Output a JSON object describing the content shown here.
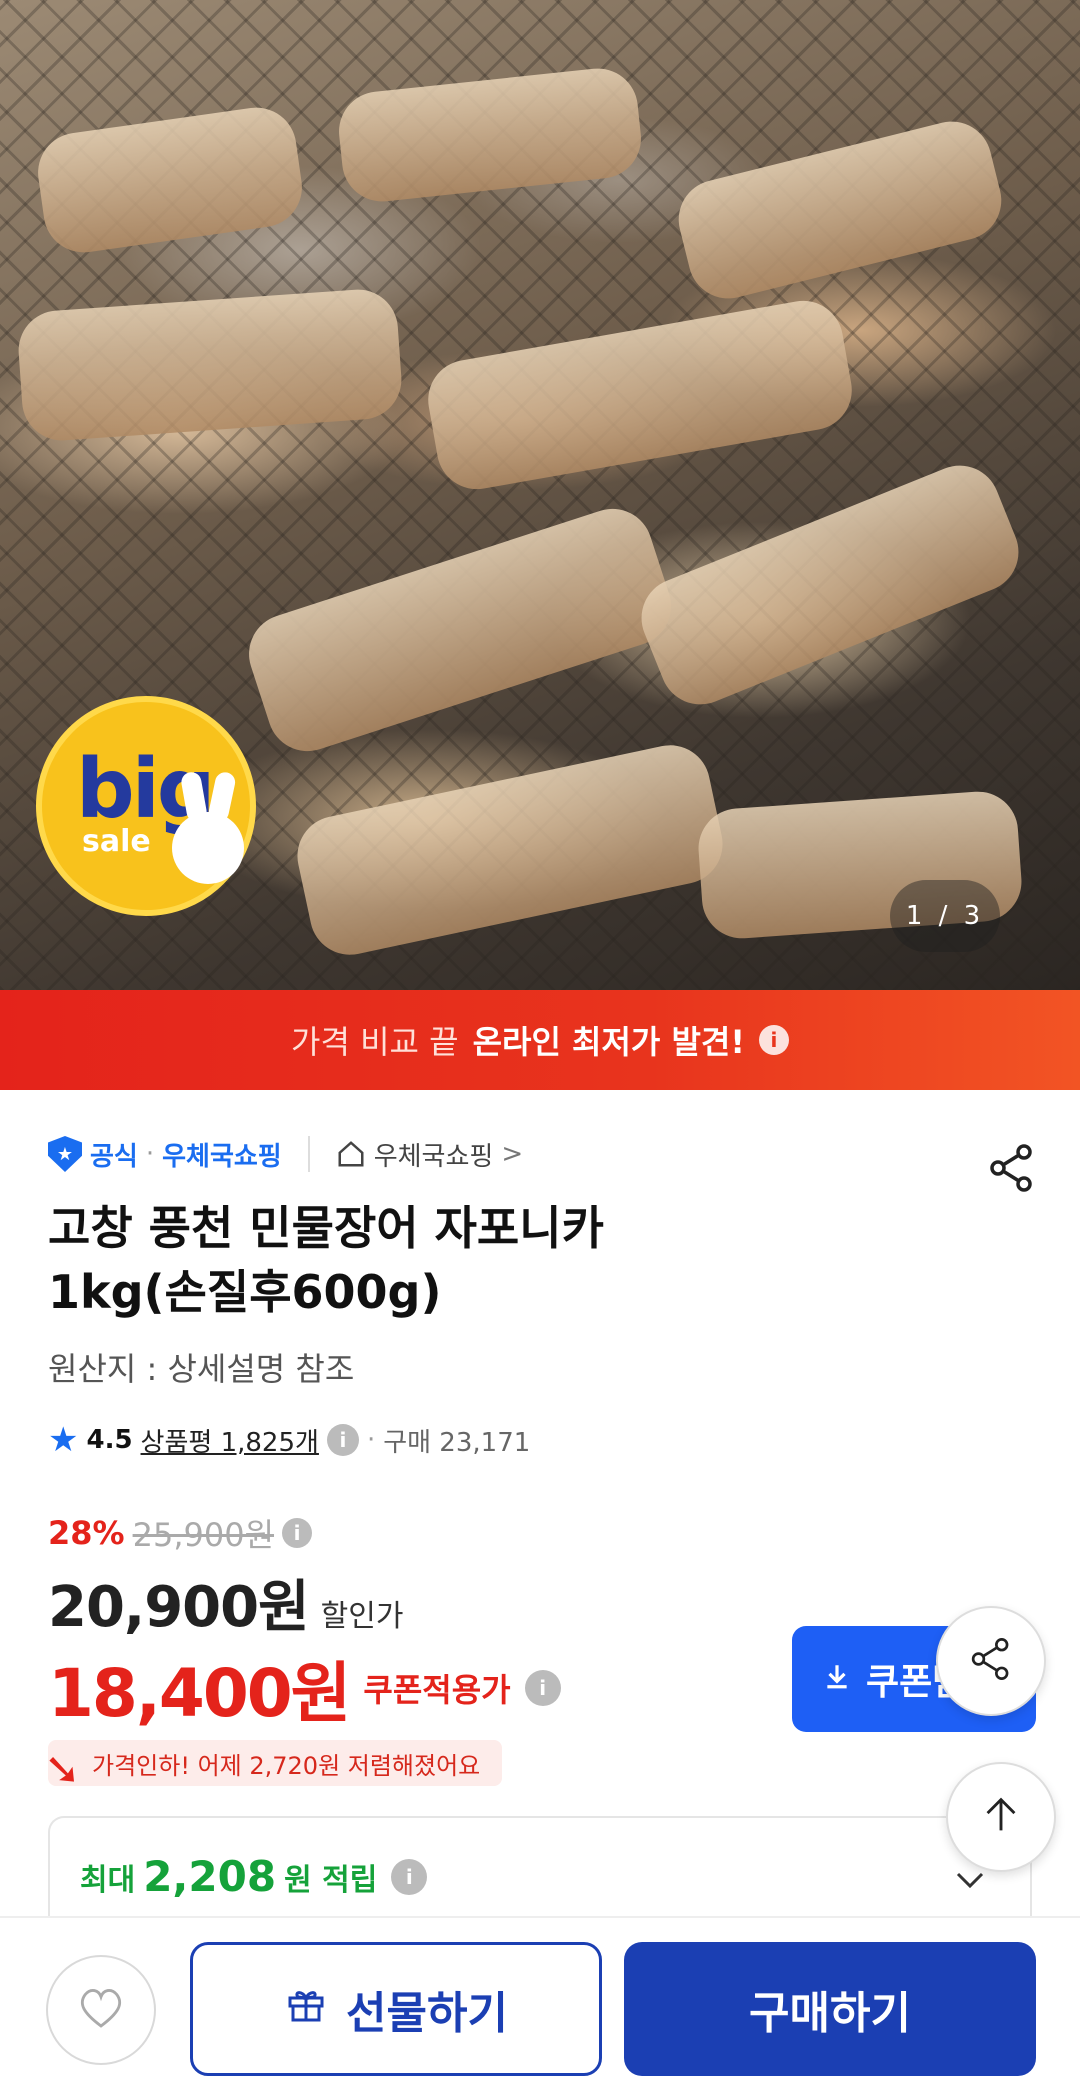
{
  "hero": {
    "badge_big": "big",
    "badge_sale": "sale",
    "image_counter": "1 / 3"
  },
  "banner": {
    "light_text": "가격 비교 끝",
    "bold_text": "온라인 최저가 발견!",
    "info": "i"
  },
  "seller": {
    "official_label": "공식",
    "separator": "·",
    "seller_name": "우체국쇼핑",
    "store_link": "우체국쇼핑",
    "store_chevron": ">"
  },
  "product": {
    "title_line1": "고창 풍천 민물장어 자포니카",
    "title_line2": "1kg(손질후600g)",
    "origin": "원산지 : 상세설명 참조"
  },
  "rating": {
    "score": "4.5",
    "reviews": "상품평 1,825개",
    "separator": "·",
    "bought": "구매 23,171"
  },
  "price": {
    "discount_pct": "28%",
    "original": "25,900원",
    "sale_price": "20,900원",
    "sale_label": "할인가",
    "coupon_price": "18,400원",
    "coupon_label": "쿠폰적용가",
    "coupon_button": "쿠폰받",
    "price_drop": "가격인하! 어제 2,720원 저렴해졌어요"
  },
  "points": {
    "prefix": "최대",
    "value": "2,208",
    "unit": "원 적립"
  },
  "bottom": {
    "gift_label": "선물하기",
    "buy_label": "구매하기"
  },
  "colors": {
    "accent_red": "#e4231b",
    "accent_blue": "#1b3fb3",
    "coupon_blue": "#1e5ff5",
    "points_green": "#15a23a"
  },
  "icons": [
    "shield-icon",
    "home-icon",
    "share-icon",
    "info-icon",
    "star-icon",
    "download-icon",
    "chevron-down-icon",
    "arrow-up-icon",
    "heart-icon",
    "gift-icon"
  ]
}
